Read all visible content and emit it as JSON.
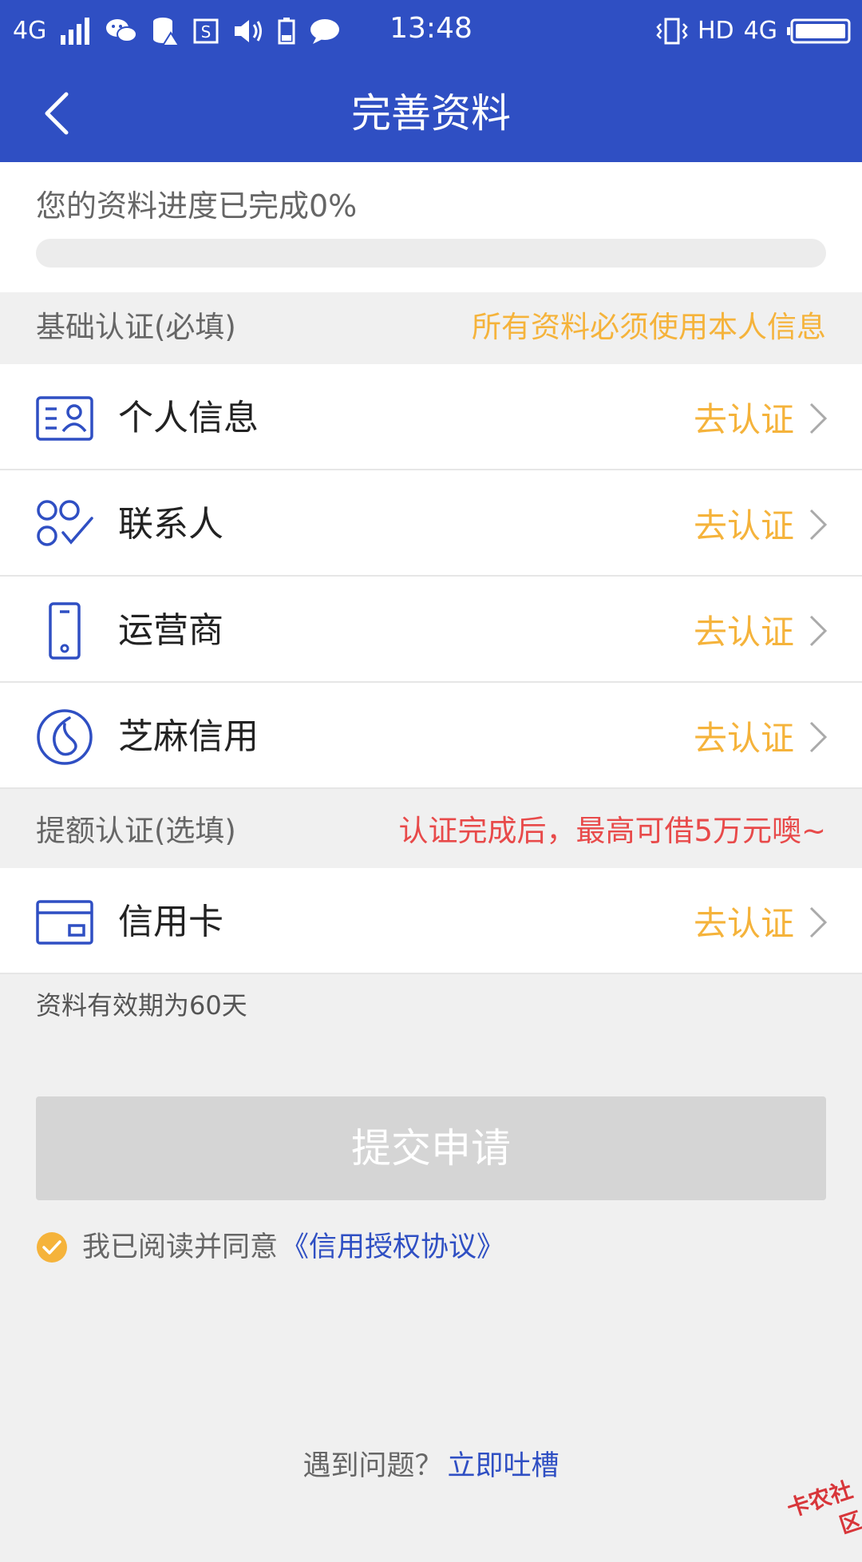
{
  "status_bar": {
    "network": "4G",
    "time": "13:48",
    "hd": "HD",
    "network_right": "4G"
  },
  "nav": {
    "title": "完善资料"
  },
  "progress": {
    "label": "您的资料进度已完成0%",
    "percent": 0
  },
  "basic_section": {
    "title": "基础认证(必填)",
    "note": "所有资料必须使用本人信息",
    "note_color": "#f5b33b",
    "items": [
      {
        "icon": "id-card-icon",
        "label": "个人信息",
        "action": "去认证"
      },
      {
        "icon": "contacts-icon",
        "label": "联系人",
        "action": "去认证"
      },
      {
        "icon": "phone-icon",
        "label": "运营商",
        "action": "去认证"
      },
      {
        "icon": "sesame-credit-icon",
        "label": "芝麻信用",
        "action": "去认证"
      }
    ]
  },
  "quota_section": {
    "title": "提额认证(选填)",
    "note": "认证完成后，最高可借5万元噢~",
    "note_color": "#e84a4a",
    "items": [
      {
        "icon": "credit-card-icon",
        "label": "信用卡",
        "action": "去认证"
      }
    ]
  },
  "validity_note": "资料有效期为60天",
  "submit": {
    "label": "提交申请"
  },
  "agreement": {
    "text": "我已阅读并同意",
    "link": "《信用授权协议》"
  },
  "help": {
    "text": "遇到问题？",
    "link": "立即吐槽"
  },
  "watermark": "卡农社区",
  "colors": {
    "primary": "#2f4fc3",
    "accent": "#f5b33b",
    "alert": "#e84a4a"
  }
}
